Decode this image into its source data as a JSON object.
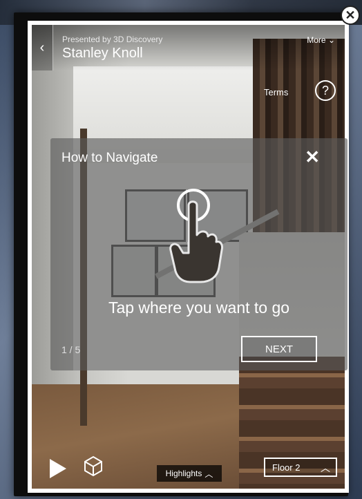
{
  "header": {
    "back_icon": "chevron-left-icon",
    "presented_by": "Presented by 3D Discovery",
    "title": "Stanley Knoll",
    "more_label": "More"
  },
  "top_right": {
    "terms_label": "Terms",
    "help_glyph": "?"
  },
  "nav_overlay": {
    "title": "How to Navigate",
    "close_glyph": "✕",
    "instruction": "Tap where you want to go",
    "pager": "1 / 5",
    "next_label": "NEXT"
  },
  "bottom": {
    "highlights_label": "Highlights",
    "floor_label": "Floor 2"
  },
  "colors": {
    "overlay_bg": "#5a5a5a",
    "text": "#ffffff"
  }
}
